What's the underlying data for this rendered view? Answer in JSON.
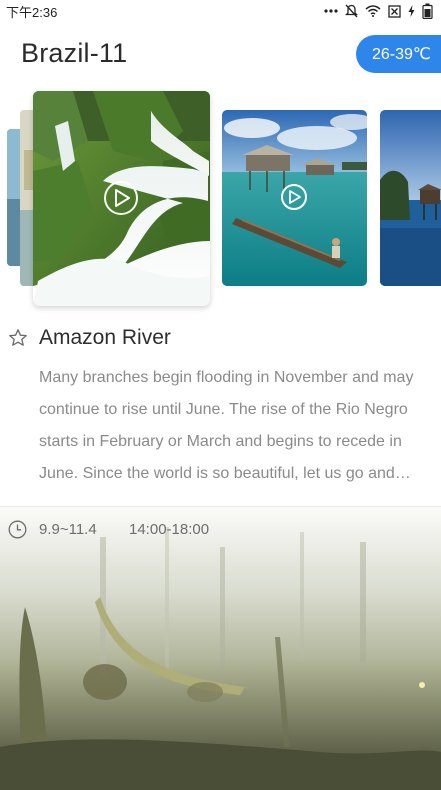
{
  "status": {
    "time": "下午2:36"
  },
  "header": {
    "title": "Brazil-11",
    "temperature": "26-39℃"
  },
  "gallery": {
    "cards": [
      {
        "scene": "waterfall",
        "has_video": true
      },
      {
        "scene": "stilt-houses",
        "has_video": true
      },
      {
        "scene": "lake-boat",
        "has_video": false
      }
    ]
  },
  "detail": {
    "title": "Amazon River",
    "description": "Many branches begin flooding in November and may continue to rise until June. The rise of the Rio Negro starts in February or March and begins to recede in June. Since the world is so beautiful, let us go and see it together.",
    "date_range": "9.9~11.4",
    "time_range": "14:00-18:00"
  },
  "colors": {
    "accent": "#2f86ea",
    "title": "#2b2b2b",
    "body_text": "#8a8a8a"
  }
}
